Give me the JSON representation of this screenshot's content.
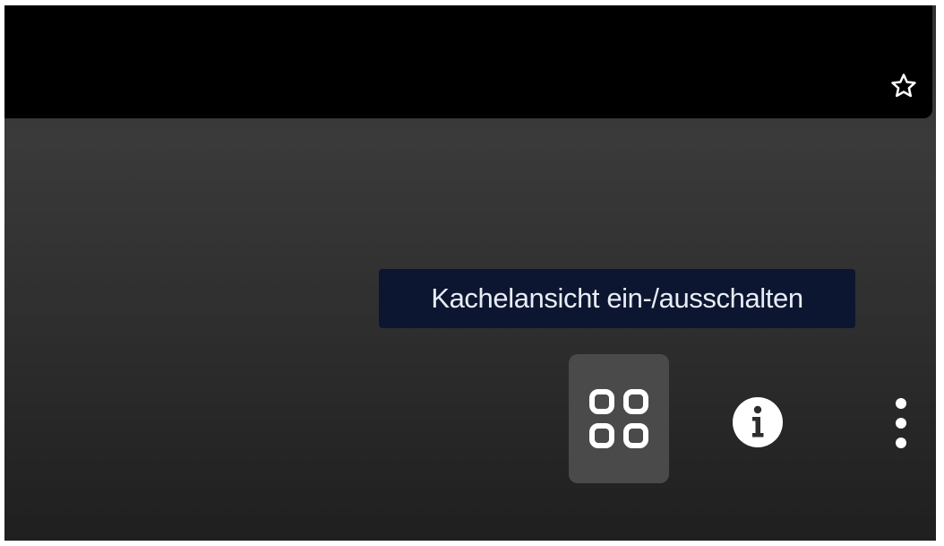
{
  "top_bar": {
    "favorite_icon": "star-outline-icon"
  },
  "tooltip": {
    "text": "Kachelansicht ein-/ausschalten"
  },
  "toolbar": {
    "tile_view_icon": "grid-2x2-icon",
    "info_icon": "info-circle-icon",
    "more_icon": "more-vertical-icon"
  },
  "colors": {
    "panel_background": "#313131",
    "top_bar": "#000000",
    "tooltip_background": "#0d1630",
    "tooltip_text": "#e8ecf6",
    "active_button_background": "#4a4a4a",
    "icon": "#ffffff"
  }
}
